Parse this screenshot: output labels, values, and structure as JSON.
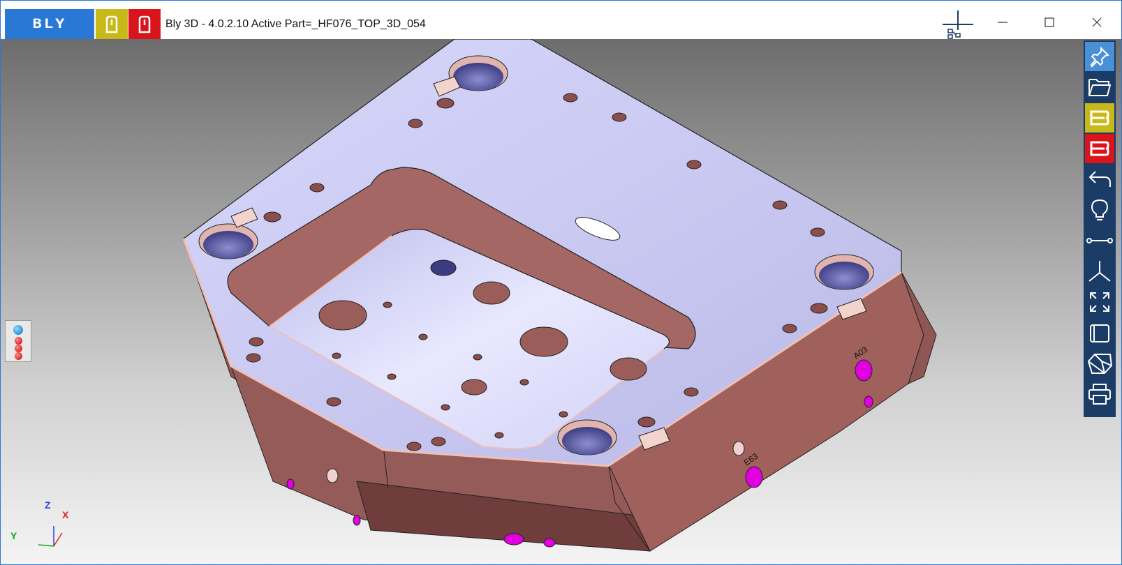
{
  "app": {
    "logo_text": "BLY",
    "title": "Bly 3D - 4.0.2.10 Active Part=_HF076_TOP_3D_054"
  },
  "colors": {
    "brand_blue": "#2a78d6",
    "brand_yellow": "#c9b81a",
    "brand_red": "#d9141b",
    "toolbar_bg": "#1a3c66",
    "part_top_face": "#cfd0f5",
    "part_side_face": "#a0605c"
  },
  "title_buttons": [
    {
      "name": "yellow-mode-button",
      "icon": "bracket-icon"
    },
    {
      "name": "red-mode-button",
      "icon": "bracket-icon"
    }
  ],
  "window_controls": [
    "network-icon",
    "minimize-icon",
    "maximize-icon",
    "close-icon"
  ],
  "right_toolbar": [
    {
      "icon": "pin-icon",
      "state": "active"
    },
    {
      "icon": "folder-open-icon"
    },
    {
      "icon": "b-logo-icon",
      "color": "yellow"
    },
    {
      "icon": "b-logo-icon",
      "color": "red"
    },
    {
      "icon": "undo-arrow-icon"
    },
    {
      "icon": "lightbulb-icon"
    },
    {
      "icon": "measure-distance-icon"
    },
    {
      "icon": "axis-triad-icon"
    },
    {
      "icon": "fit-view-icon"
    },
    {
      "icon": "window-view-icon"
    },
    {
      "icon": "shaded-solid-icon"
    },
    {
      "icon": "print-icon"
    }
  ],
  "axis_triad": {
    "z": "Z",
    "x": "X",
    "y": "Y"
  },
  "part_labels": {
    "side_label_1": "A03",
    "side_label_2": "E63"
  }
}
